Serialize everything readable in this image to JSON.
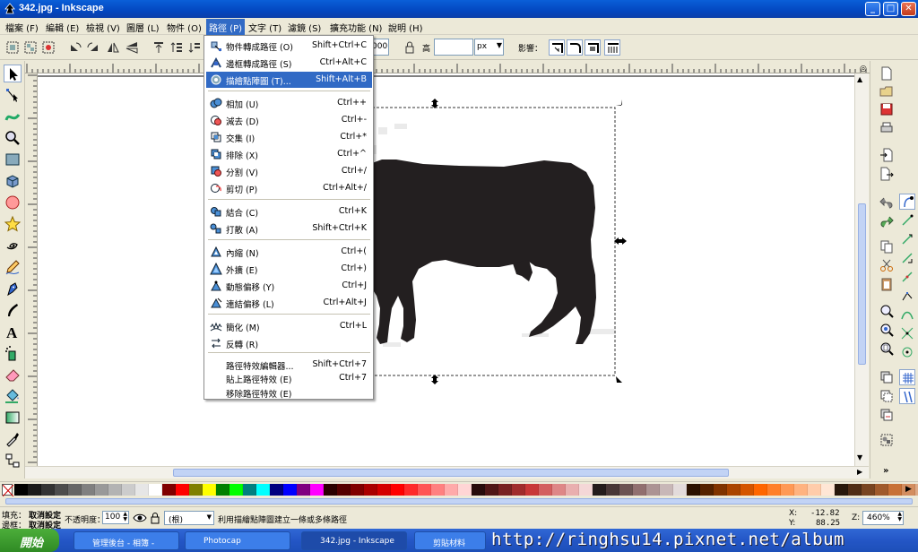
{
  "window": {
    "title": "342.jpg - Inkscape"
  },
  "menubar": [
    {
      "label": "檔案 (F)"
    },
    {
      "label": "編輯 (E)"
    },
    {
      "label": "檢視 (V)"
    },
    {
      "label": "圖層 (L)"
    },
    {
      "label": "物件 (O)"
    },
    {
      "label": "路徑 (P)"
    },
    {
      "label": "文字 (T)"
    },
    {
      "label": "濾鏡 (S)"
    },
    {
      "label": "擴充功能 (N)"
    },
    {
      "label": "說明 (H)"
    }
  ],
  "toolbar": {
    "w_value": "000",
    "h_label": "高",
    "h_value": "",
    "unit": "px",
    "affect_label": "影響："
  },
  "path_menu": {
    "items": [
      {
        "label": "物件轉成路徑 (O)",
        "shortcut": "Shift+Ctrl+C",
        "icon": "object-to-path-icon"
      },
      {
        "label": "邊框轉成路徑 (S)",
        "shortcut": "Ctrl+Alt+C",
        "icon": "stroke-to-path-icon"
      },
      {
        "label": "描繪點陣圖 (T)...",
        "shortcut": "Shift+Alt+B",
        "icon": "trace-bitmap-icon",
        "highlighted": true
      },
      {
        "label": "相加 (U)",
        "shortcut": "Ctrl++",
        "icon": "union-icon"
      },
      {
        "label": "減去 (D)",
        "shortcut": "Ctrl+-",
        "icon": "difference-icon"
      },
      {
        "label": "交集 (I)",
        "shortcut": "Ctrl+*",
        "icon": "intersection-icon"
      },
      {
        "label": "排除 (X)",
        "shortcut": "Ctrl+^",
        "icon": "exclusion-icon"
      },
      {
        "label": "分割 (V)",
        "shortcut": "Ctrl+/",
        "icon": "division-icon"
      },
      {
        "label": "剪切 (P)",
        "shortcut": "Ctrl+Alt+/",
        "icon": "cut-path-icon"
      },
      {
        "label": "結合 (C)",
        "shortcut": "Ctrl+K",
        "icon": "combine-icon"
      },
      {
        "label": "打散 (A)",
        "shortcut": "Shift+Ctrl+K",
        "icon": "break-apart-icon"
      },
      {
        "label": "內縮 (N)",
        "shortcut": "Ctrl+(",
        "icon": "inset-icon"
      },
      {
        "label": "外擴 (E)",
        "shortcut": "Ctrl+)",
        "icon": "outset-icon"
      },
      {
        "label": "動態偏移 (Y)",
        "shortcut": "Ctrl+J",
        "icon": "dynamic-offset-icon"
      },
      {
        "label": "連結偏移 (L)",
        "shortcut": "Ctrl+Alt+J",
        "icon": "linked-offset-icon"
      },
      {
        "label": "簡化 (M)",
        "shortcut": "Ctrl+L",
        "icon": "simplify-icon"
      },
      {
        "label": "反轉 (R)",
        "shortcut": "",
        "icon": "reverse-icon"
      },
      {
        "label": "路徑特效編輯器...",
        "shortcut": "Shift+Ctrl+7",
        "icon": ""
      },
      {
        "label": "貼上路徑特效 (E)",
        "shortcut": "Ctrl+7",
        "icon": ""
      },
      {
        "label": "移除路徑特效 (E)",
        "shortcut": "",
        "icon": ""
      }
    ]
  },
  "palette": {
    "colors": [
      "#000000",
      "#1a1a1a",
      "#333333",
      "#4d4d4d",
      "#666666",
      "#808080",
      "#999999",
      "#b3b3b3",
      "#cccccc",
      "#e6e6e6",
      "#ffffff",
      "#800000",
      "#ff0000",
      "#808000",
      "#ffff00",
      "#008000",
      "#00ff00",
      "#008080",
      "#00ffff",
      "#000080",
      "#0000ff",
      "#800080",
      "#ff00ff",
      "#2b0000",
      "#550000",
      "#800000",
      "#aa0000",
      "#d40000",
      "#ff0000",
      "#ff2a2a",
      "#ff5555",
      "#ff8080",
      "#ffaaaa",
      "#ffd5d5",
      "#280b0b",
      "#501616",
      "#782121",
      "#a02c2c",
      "#c83737",
      "#d35f5f",
      "#de8787",
      "#e9afaf",
      "#f4d7d7",
      "#241c1c",
      "#483737",
      "#6c5353",
      "#916f6f",
      "#ac9393",
      "#c8b7b7",
      "#e3dbdb",
      "#2b1100",
      "#552200",
      "#803300",
      "#aa4400",
      "#d45500",
      "#ff6600",
      "#ff7f2a",
      "#ff9955",
      "#ffb380",
      "#ffccaa",
      "#ffe6d5",
      "#28170b",
      "#502d16",
      "#784421",
      "#a05a2c",
      "#c87137",
      "#d38d5f",
      "#deaa87",
      "#e9c6af"
    ]
  },
  "statusbar": {
    "fill_label": "填充：",
    "fill_value": "取消設定",
    "stroke_label": "邊框：",
    "stroke_value": "取消設定",
    "opacity_label": "不透明度：",
    "opacity_value": "100",
    "layer_value": "(根)",
    "message": "利用描繪點陣圖建立一條或多條路徑",
    "x_label": "X:",
    "x_value": "-12.82",
    "y_label": "Y:",
    "y_value": "88.25",
    "zoom_label": "Z:",
    "zoom_value": "460%"
  },
  "taskbar": {
    "start_label": "開始",
    "tasks": [
      {
        "label": "管理後台 - 相簿 -"
      },
      {
        "label": "Photocap"
      },
      {
        "label": "342.jpg - Inkscape",
        "active": true
      },
      {
        "label": "剪貼材料"
      }
    ],
    "watermark": "http://ringhsu14.pixnet.net/album"
  }
}
